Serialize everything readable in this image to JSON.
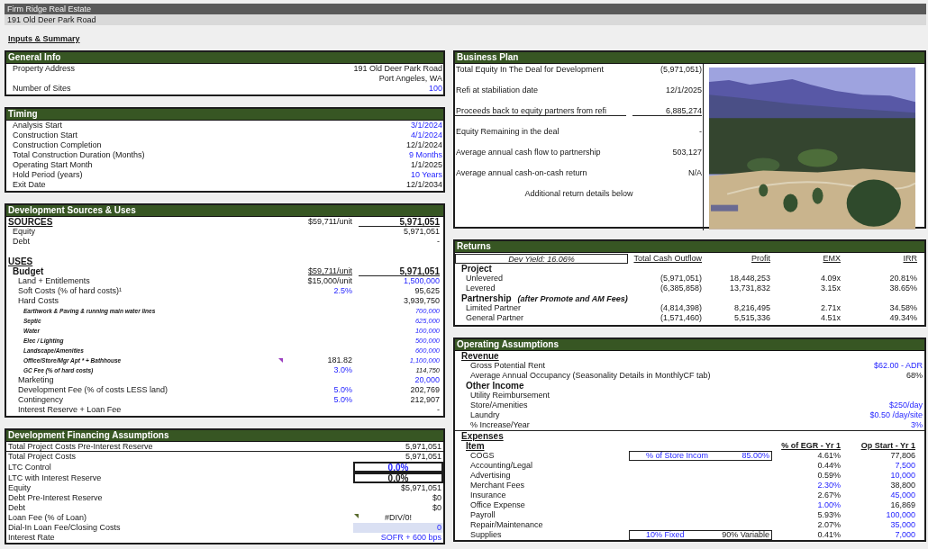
{
  "header": {
    "company": "Firm Ridge Real Estate",
    "address": "191 Old Deer Park Road"
  },
  "page_title": "Inputs & Summary",
  "general_info": {
    "title": "General Info",
    "rows": [
      {
        "label": "Property Address",
        "value": "191 Old Deer Park Road",
        "input": false
      },
      {
        "value": "Port Angeles, WA",
        "input": false
      },
      {
        "label": "Number of Sites",
        "value": "100",
        "input": true
      }
    ]
  },
  "timing": {
    "title": "Timing",
    "rows": [
      {
        "label": "Analysis Start",
        "value": "3/1/2024",
        "input": true
      },
      {
        "label": "Construction Start",
        "value": "4/1/2024",
        "input": true
      },
      {
        "label": "Construction Completion",
        "value": "12/1/2024",
        "input": false
      },
      {
        "label": "Total Construction Duration (Months)",
        "value": "9 Months",
        "input": true
      },
      {
        "label": "Operating Start Month",
        "value": "1/1/2025",
        "input": false
      },
      {
        "label": "Hold Period (years)",
        "value": "10 Years",
        "input": true
      },
      {
        "label": "Exit Date",
        "value": "12/1/2034",
        "input": false
      }
    ]
  },
  "sources_uses": {
    "title": "Development Sources & Uses",
    "rows": [
      {
        "kind": "heading",
        "label": "SOURCES",
        "note": "$59,711/unit",
        "value": "5,971,051"
      },
      {
        "kind": "line",
        "label": "Equity",
        "value": "5,971,051",
        "input": false
      },
      {
        "kind": "line",
        "label": "Debt",
        "value": "-",
        "input": false
      },
      {
        "kind": "heading",
        "label": "USES"
      },
      {
        "kind": "total",
        "label": "Budget",
        "note": "$59,711/unit",
        "value": "5,971,051"
      },
      {
        "kind": "item",
        "label": "Land + Entitlements",
        "note": "$15,000/unit",
        "note_input": false,
        "value": "1,500,000",
        "input": true
      },
      {
        "kind": "item",
        "label": "Soft Costs (% of hard costs)¹",
        "note": "2.5%",
        "note_input": true,
        "value": "95,625",
        "input": false
      },
      {
        "kind": "item",
        "label": "Hard Costs",
        "value": "3,939,750",
        "input": false,
        "children": [
          {
            "label": "Earthwork & Paving & running main water lines",
            "value": "700,000",
            "input": true,
            "comment": false
          },
          {
            "label": "Septic",
            "value": "625,000",
            "input": true,
            "comment": false
          },
          {
            "label": "Water",
            "value": "100,000",
            "input": true,
            "comment": false
          },
          {
            "label": "Elec / Lighting",
            "value": "500,000",
            "input": true,
            "comment": false
          },
          {
            "label": "Landscape/Amenities",
            "value": "600,000",
            "input": true,
            "comment": false
          },
          {
            "label": "Office/Store/Mgr Apt * + Bathhouse",
            "note": "181.82",
            "note_input": false,
            "value": "1,100,000",
            "input": true,
            "comment": true
          },
          {
            "label": "GC Fee (% of hard costs)",
            "note": "3.0%",
            "note_input": true,
            "value": "114,750",
            "input": false,
            "comment": false
          }
        ]
      },
      {
        "kind": "item",
        "label": "Marketing",
        "value": "20,000",
        "input": true
      },
      {
        "kind": "item",
        "label": "Development Fee (% of costs LESS land)",
        "note": "5.0%",
        "note_input": true,
        "value": "202,769",
        "input": false
      },
      {
        "kind": "item",
        "label": "Contingency",
        "note": "5.0%",
        "note_input": true,
        "value": "212,907",
        "input": false
      },
      {
        "kind": "item",
        "label": "Interest Reserve + Loan Fee",
        "value": "-",
        "input": false
      }
    ]
  },
  "financing": {
    "title": "Development Financing Assumptions",
    "rows": [
      {
        "kind": "subtotal",
        "label": "Total Project Costs Pre-Interest Reserve",
        "value": "5,971,051",
        "input": false,
        "comment": false
      },
      {
        "kind": "plain",
        "label": "Total Project Costs",
        "value": "5,971,051",
        "input": false,
        "comment": false
      },
      {
        "kind": "boxed",
        "label": "LTC Control",
        "value": "0.0%",
        "input": true,
        "comment": false
      },
      {
        "kind": "boxed",
        "label": "LTC with Interest Reserve",
        "value": "0.0%",
        "input": false,
        "comment": false
      },
      {
        "kind": "plain",
        "label": "Equity",
        "value": "$5,971,051",
        "input": false,
        "comment": false
      },
      {
        "kind": "plain",
        "label": "Debt Pre-Interest Reserve",
        "value": "$0",
        "input": false,
        "comment": false
      },
      {
        "kind": "plain",
        "label": "Debt",
        "value": "$0",
        "input": false,
        "comment": false
      },
      {
        "kind": "centered",
        "label": "Loan Fee (% of Loan)",
        "value": "#DIV/0!",
        "input": false,
        "comment": true
      },
      {
        "kind": "shaded",
        "label": "Dial-In Loan Fee/Closing Costs",
        "value": "0",
        "input": true,
        "comment": false
      },
      {
        "kind": "plain",
        "label": "Interest Rate",
        "value": "SOFR + 600 bps",
        "input": true,
        "comment": false
      }
    ]
  },
  "business_plan": {
    "title": "Business Plan",
    "rows": [
      {
        "label": "Total Equity In The Deal for Development",
        "value": "(5,971,051)",
        "underlined": false
      },
      {
        "label": "Refi at stabiliation date",
        "value": "12/1/2025",
        "underlined": false
      },
      {
        "label": "Proceeds back to equity partners from refi",
        "value": "6,885,274",
        "underlined": true
      },
      {
        "label": "Equity Remaining in the deal",
        "value": "-",
        "underlined": false
      },
      {
        "label": "Average annual cash flow to partnership",
        "value": "503,127",
        "underlined": false
      },
      {
        "label": "Average annual cash-on-cash return",
        "value": "N/A",
        "underlined": false
      }
    ],
    "note": "Additional return details below"
  },
  "returns": {
    "title": "Returns",
    "dev_yield": "Dev Yield: 16.06%",
    "columns": [
      "Total Cash Outflow",
      "Profit",
      "EMX",
      "IRR"
    ],
    "groups": [
      {
        "label": "Project",
        "rows": [
          {
            "label": "Unlevered",
            "values": [
              "(5,971,051)",
              "18,448,253",
              "4.09x",
              "20.81%"
            ]
          },
          {
            "label": "Levered",
            "values": [
              "(6,385,858)",
              "13,731,832",
              "3.15x",
              "38.65%"
            ]
          }
        ]
      },
      {
        "label": "Partnership",
        "note": "(after Promote and AM Fees)",
        "rows": [
          {
            "label": "Limited Partner",
            "values": [
              "(4,814,398)",
              "8,216,495",
              "2.71x",
              "34.58%"
            ]
          },
          {
            "label": "General Partner",
            "values": [
              "(1,571,460)",
              "5,515,336",
              "4.51x",
              "49.34%"
            ]
          }
        ]
      }
    ]
  },
  "operating": {
    "title": "Operating Assumptions",
    "revenue": {
      "heading": "Revenue",
      "rows": [
        {
          "label": "Gross Potential Rent",
          "value": "$62.00 - ADR",
          "input": true
        },
        {
          "label": "Average Annual Occupancy (Seasonality Details in MonthlyCF tab)",
          "value": "68%",
          "input": false
        }
      ]
    },
    "other_income": {
      "heading": "Other Income",
      "rows": [
        {
          "label": "Utility Reimbursement"
        },
        {
          "label": "Store/Amenities",
          "value": "$250/day",
          "input": true
        },
        {
          "label": "Laundry",
          "value": "$0.50 /day/site",
          "input": true
        },
        {
          "label": "% Increase/Year",
          "value": "3%",
          "input": true
        }
      ]
    },
    "expenses": {
      "heading": "Expenses",
      "columns": [
        "Item",
        "% of EGR - Yr 1",
        "Op Start - Yr 1"
      ],
      "rows": [
        {
          "label": "COGS",
          "basis": [
            {
              "text": "% of Store Incom",
              "input": true
            },
            {
              "text": "85.00%",
              "input": true
            }
          ],
          "pct": "4.61%",
          "pct_input": false,
          "amount": "77,806",
          "amount_input": false
        },
        {
          "label": "Accounting/Legal",
          "pct": "0.44%",
          "pct_input": false,
          "amount": "7,500",
          "amount_input": true
        },
        {
          "label": "Advertising",
          "pct": "0.59%",
          "pct_input": false,
          "amount": "10,000",
          "amount_input": true
        },
        {
          "label": "Merchant Fees",
          "pct": "2.30%",
          "pct_input": true,
          "amount": "38,800",
          "amount_input": false
        },
        {
          "label": "Insurance",
          "pct": "2.67%",
          "pct_input": false,
          "amount": "45,000",
          "amount_input": true
        },
        {
          "label": "Office Expense",
          "pct": "1.00%",
          "pct_input": true,
          "amount": "16,869",
          "amount_input": false
        },
        {
          "label": "Payroll",
          "pct": "5.93%",
          "pct_input": false,
          "amount": "100,000",
          "amount_input": true
        },
        {
          "label": "Repair/Maintenance",
          "pct": "2.07%",
          "pct_input": false,
          "amount": "35,000",
          "amount_input": true
        },
        {
          "label": "Supplies",
          "basis": [
            {
              "text": "10% Fixed",
              "input": true
            },
            {
              "text": "90% Variable",
              "input": false
            }
          ],
          "pct": "0.41%",
          "pct_input": false,
          "amount": "7,000",
          "amount_input": true
        }
      ]
    }
  }
}
